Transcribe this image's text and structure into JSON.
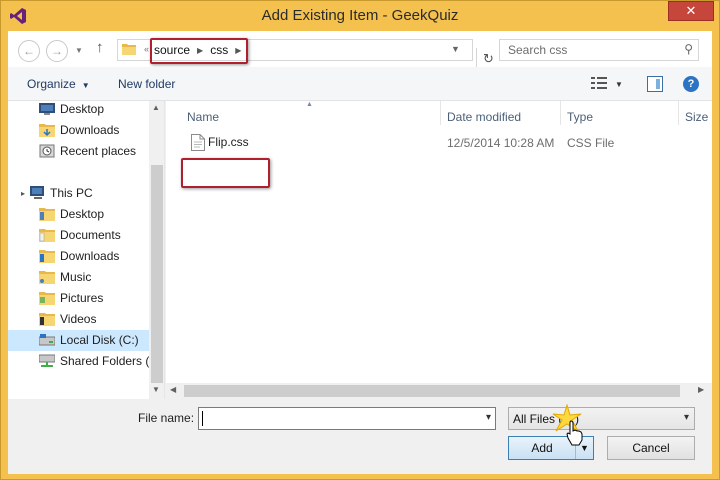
{
  "window": {
    "title": "Add Existing Item - GeekQuiz",
    "close_symbol": "✕",
    "title_bar_color": "#f4c14f",
    "app_icon": "visual-studio-icon"
  },
  "navigation": {
    "back_icon": "back-arrow-icon",
    "back_glyph": "←",
    "forward_icon": "forward-arrow-icon",
    "forward_glyph": "→",
    "up_icon": "up-arrow-icon",
    "up_glyph": "↑",
    "address": {
      "overflow_chevron": "«",
      "breadcrumbs": [
        "source",
        "css"
      ],
      "refresh_glyph": "↻"
    },
    "search": {
      "placeholder": "Search css"
    }
  },
  "command_bar": {
    "organize_label": "Organize",
    "new_folder_label": "New folder"
  },
  "nav_pane": {
    "favorites": [
      {
        "label": "Desktop",
        "icon": "desktop-icon"
      },
      {
        "label": "Downloads",
        "icon": "downloads-folder-icon"
      },
      {
        "label": "Recent places",
        "icon": "recent-places-icon"
      }
    ],
    "this_pc_label": "This PC",
    "this_pc_items": [
      {
        "label": "Desktop",
        "icon": "folder-icon"
      },
      {
        "label": "Documents",
        "icon": "folder-icon"
      },
      {
        "label": "Downloads",
        "icon": "folder-icon"
      },
      {
        "label": "Music",
        "icon": "folder-icon"
      },
      {
        "label": "Pictures",
        "icon": "folder-icon"
      },
      {
        "label": "Videos",
        "icon": "folder-icon"
      },
      {
        "label": "Local Disk (C:)",
        "icon": "drive-icon",
        "selected": true
      },
      {
        "label": "Shared Folders (\\",
        "icon": "network-drive-icon"
      }
    ]
  },
  "file_list": {
    "columns": [
      "Name",
      "Date modified",
      "Type",
      "Size"
    ],
    "files": [
      {
        "name": "Flip.css",
        "date_modified": "12/5/2014 10:28 AM",
        "type": "CSS File"
      }
    ]
  },
  "footer": {
    "file_name_label": "File name:",
    "file_name_value": "",
    "file_type_filter": "All Files (*.*)",
    "add_label": "Add",
    "cancel_label": "Cancel"
  },
  "annotation_color": "#b01f2e"
}
